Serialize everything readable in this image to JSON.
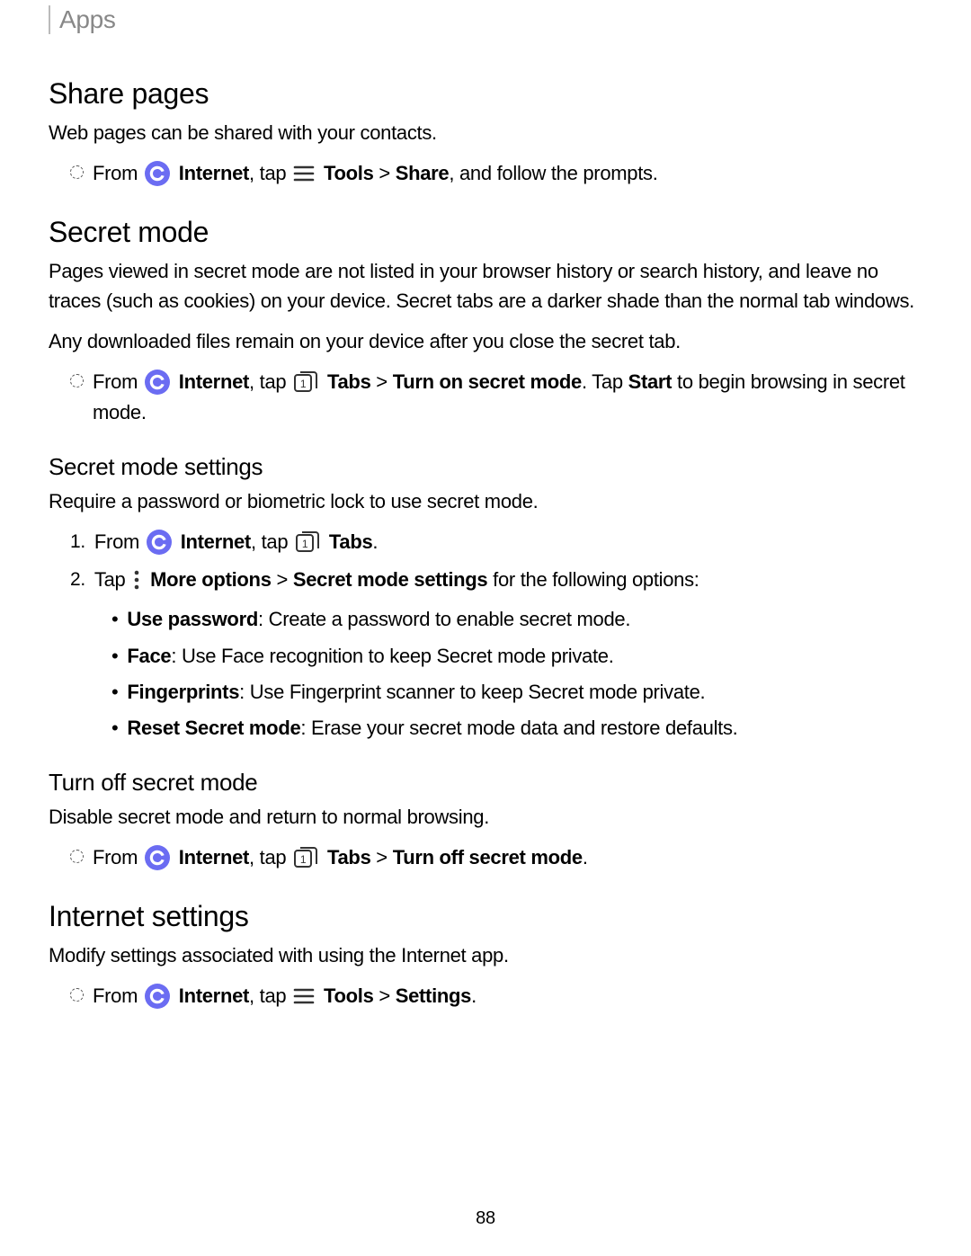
{
  "header": "Apps",
  "page_number": "88",
  "sections": {
    "share_pages": {
      "title": "Share pages",
      "intro": "Web pages can be shared with your contacts.",
      "step_prefix": "From ",
      "app_name": "Internet",
      "tap": ", tap ",
      "tools": "Tools",
      "gt": " > ",
      "share": "Share",
      "suffix": ", and follow the prompts."
    },
    "secret_mode": {
      "title": "Secret mode",
      "p1": "Pages viewed in secret mode are not listed in your browser history or search history, and leave no traces (such as cookies) on your device. Secret tabs are a darker shade than the normal tab windows.",
      "p2": "Any downloaded files remain on your device after you close the secret tab.",
      "step_prefix": "From ",
      "app_name": "Internet",
      "tap": ", tap ",
      "tabs": "Tabs",
      "gt": " > ",
      "turn_on": "Turn on secret mode",
      "mid": ". Tap ",
      "start": "Start",
      "suffix": " to begin browsing in secret mode."
    },
    "secret_mode_settings": {
      "title": "Secret mode settings",
      "intro": "Require a password or biometric lock to use secret mode.",
      "step1_prefix": "From ",
      "app_name": "Internet",
      "tap": ", tap ",
      "tabs": "Tabs",
      "period": ".",
      "step2_prefix": "Tap ",
      "more_options": "More options",
      "gt": " > ",
      "path": "Secret mode settings",
      "suffix": " for the following options:",
      "options": {
        "o1b": "Use password",
        "o1t": ": Create a password to enable secret mode.",
        "o2b": "Face",
        "o2t": ": Use Face recognition to keep Secret mode private.",
        "o3b": "Fingerprints",
        "o3t": ": Use Fingerprint scanner to keep Secret mode private.",
        "o4b": "Reset Secret mode",
        "o4t": ": Erase your secret mode data and restore defaults."
      }
    },
    "turn_off": {
      "title": "Turn off secret mode",
      "intro": "Disable secret mode and return to normal browsing.",
      "step_prefix": "From ",
      "app_name": "Internet",
      "tap": ", tap ",
      "tabs": "Tabs",
      "gt": " > ",
      "turn_off": "Turn off secret mode",
      "period": "."
    },
    "internet_settings": {
      "title": "Internet settings",
      "intro": "Modify settings associated with using the Internet app.",
      "step_prefix": "From ",
      "app_name": "Internet",
      "tap": ", tap ",
      "tools": "Tools",
      "gt": " > ",
      "settings": "Settings",
      "period": "."
    }
  }
}
